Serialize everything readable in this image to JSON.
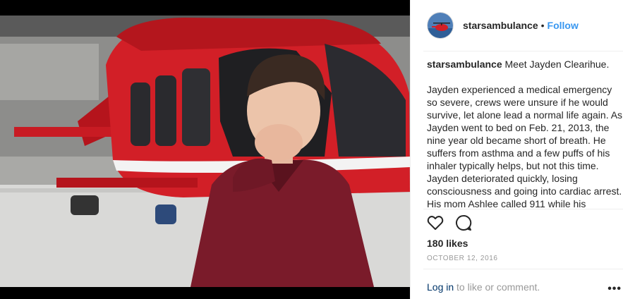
{
  "post": {
    "username": "starsambulance",
    "follow_label": "Follow",
    "separator": "•",
    "avatar_icon": "helicopter-avatar-icon",
    "caption_user": "starsambulance",
    "caption_title": "Meet Jayden Clearihue.",
    "caption_body": "Jayden experienced a medical emergency so severe, crews were unsure if he would survive, let alone lead a normal life again. As Jayden went to bed on Feb. 21, 2013, the nine year old became short of breath. He suffers from asthma and a few puffs of his inhaler typically helps, but not this time. Jayden deteriorated quickly, losing consciousness and going into cardiac arrest. His mom Ashlee called 911 while his",
    "likes": "180 likes",
    "date": "OCTOBER 12, 2016",
    "login_label": "Log in",
    "login_suffix": " to like or comment.",
    "more_label": "•••",
    "icons": {
      "like": "heart-icon",
      "comment": "comment-icon"
    }
  },
  "colors": {
    "follow": "#3897f0",
    "helicopter": "#d21f27",
    "shirt": "#7a1b2a"
  }
}
